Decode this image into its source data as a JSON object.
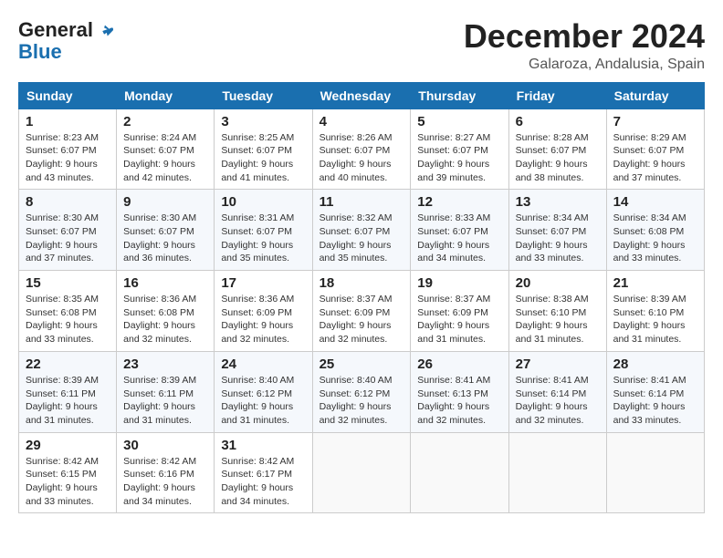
{
  "header": {
    "logo_line1": "General",
    "logo_line2": "Blue",
    "month": "December 2024",
    "location": "Galaroza, Andalusia, Spain"
  },
  "weekdays": [
    "Sunday",
    "Monday",
    "Tuesday",
    "Wednesday",
    "Thursday",
    "Friday",
    "Saturday"
  ],
  "weeks": [
    [
      {
        "day": "1",
        "sunrise": "8:23 AM",
        "sunset": "6:07 PM",
        "daylight": "9 hours and 43 minutes."
      },
      {
        "day": "2",
        "sunrise": "8:24 AM",
        "sunset": "6:07 PM",
        "daylight": "9 hours and 42 minutes."
      },
      {
        "day": "3",
        "sunrise": "8:25 AM",
        "sunset": "6:07 PM",
        "daylight": "9 hours and 41 minutes."
      },
      {
        "day": "4",
        "sunrise": "8:26 AM",
        "sunset": "6:07 PM",
        "daylight": "9 hours and 40 minutes."
      },
      {
        "day": "5",
        "sunrise": "8:27 AM",
        "sunset": "6:07 PM",
        "daylight": "9 hours and 39 minutes."
      },
      {
        "day": "6",
        "sunrise": "8:28 AM",
        "sunset": "6:07 PM",
        "daylight": "9 hours and 38 minutes."
      },
      {
        "day": "7",
        "sunrise": "8:29 AM",
        "sunset": "6:07 PM",
        "daylight": "9 hours and 37 minutes."
      }
    ],
    [
      {
        "day": "8",
        "sunrise": "8:30 AM",
        "sunset": "6:07 PM",
        "daylight": "9 hours and 37 minutes."
      },
      {
        "day": "9",
        "sunrise": "8:30 AM",
        "sunset": "6:07 PM",
        "daylight": "9 hours and 36 minutes."
      },
      {
        "day": "10",
        "sunrise": "8:31 AM",
        "sunset": "6:07 PM",
        "daylight": "9 hours and 35 minutes."
      },
      {
        "day": "11",
        "sunrise": "8:32 AM",
        "sunset": "6:07 PM",
        "daylight": "9 hours and 35 minutes."
      },
      {
        "day": "12",
        "sunrise": "8:33 AM",
        "sunset": "6:07 PM",
        "daylight": "9 hours and 34 minutes."
      },
      {
        "day": "13",
        "sunrise": "8:34 AM",
        "sunset": "6:07 PM",
        "daylight": "9 hours and 33 minutes."
      },
      {
        "day": "14",
        "sunrise": "8:34 AM",
        "sunset": "6:08 PM",
        "daylight": "9 hours and 33 minutes."
      }
    ],
    [
      {
        "day": "15",
        "sunrise": "8:35 AM",
        "sunset": "6:08 PM",
        "daylight": "9 hours and 33 minutes."
      },
      {
        "day": "16",
        "sunrise": "8:36 AM",
        "sunset": "6:08 PM",
        "daylight": "9 hours and 32 minutes."
      },
      {
        "day": "17",
        "sunrise": "8:36 AM",
        "sunset": "6:09 PM",
        "daylight": "9 hours and 32 minutes."
      },
      {
        "day": "18",
        "sunrise": "8:37 AM",
        "sunset": "6:09 PM",
        "daylight": "9 hours and 32 minutes."
      },
      {
        "day": "19",
        "sunrise": "8:37 AM",
        "sunset": "6:09 PM",
        "daylight": "9 hours and 31 minutes."
      },
      {
        "day": "20",
        "sunrise": "8:38 AM",
        "sunset": "6:10 PM",
        "daylight": "9 hours and 31 minutes."
      },
      {
        "day": "21",
        "sunrise": "8:39 AM",
        "sunset": "6:10 PM",
        "daylight": "9 hours and 31 minutes."
      }
    ],
    [
      {
        "day": "22",
        "sunrise": "8:39 AM",
        "sunset": "6:11 PM",
        "daylight": "9 hours and 31 minutes."
      },
      {
        "day": "23",
        "sunrise": "8:39 AM",
        "sunset": "6:11 PM",
        "daylight": "9 hours and 31 minutes."
      },
      {
        "day": "24",
        "sunrise": "8:40 AM",
        "sunset": "6:12 PM",
        "daylight": "9 hours and 31 minutes."
      },
      {
        "day": "25",
        "sunrise": "8:40 AM",
        "sunset": "6:12 PM",
        "daylight": "9 hours and 32 minutes."
      },
      {
        "day": "26",
        "sunrise": "8:41 AM",
        "sunset": "6:13 PM",
        "daylight": "9 hours and 32 minutes."
      },
      {
        "day": "27",
        "sunrise": "8:41 AM",
        "sunset": "6:14 PM",
        "daylight": "9 hours and 32 minutes."
      },
      {
        "day": "28",
        "sunrise": "8:41 AM",
        "sunset": "6:14 PM",
        "daylight": "9 hours and 33 minutes."
      }
    ],
    [
      {
        "day": "29",
        "sunrise": "8:42 AM",
        "sunset": "6:15 PM",
        "daylight": "9 hours and 33 minutes."
      },
      {
        "day": "30",
        "sunrise": "8:42 AM",
        "sunset": "6:16 PM",
        "daylight": "9 hours and 34 minutes."
      },
      {
        "day": "31",
        "sunrise": "8:42 AM",
        "sunset": "6:17 PM",
        "daylight": "9 hours and 34 minutes."
      },
      null,
      null,
      null,
      null
    ]
  ]
}
